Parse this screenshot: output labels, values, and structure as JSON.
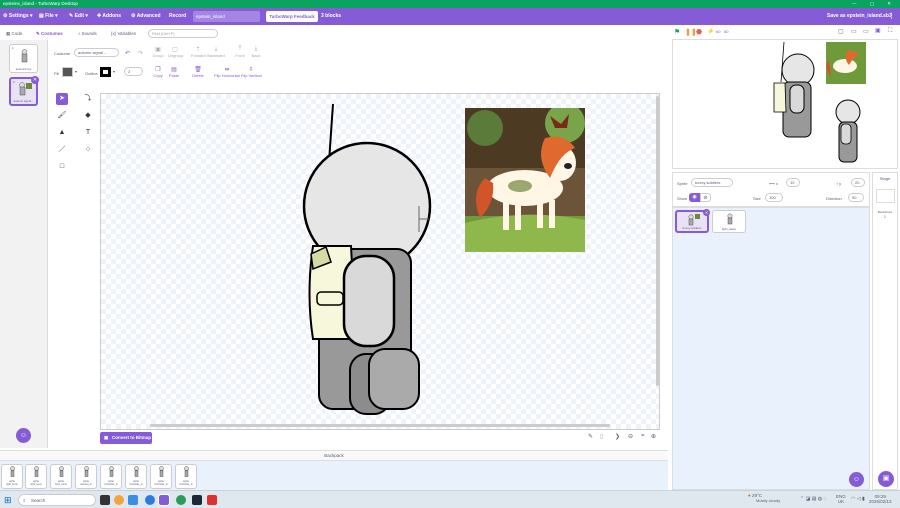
{
  "window": {
    "title": "epsteins_island - TurboWarp Desktop",
    "controls": "— ▢ ✕"
  },
  "menu": {
    "settings": "Settings",
    "file": "File",
    "edit": "Edit",
    "addons": "Addons",
    "advanced": "Advanced",
    "record": "Record",
    "project_name": "epstein_island",
    "feedback": "TurboWarp Feedback",
    "blocks_count": "3 blocks",
    "save_as": "Save as epstein_island.sb3"
  },
  "tabs": {
    "code": "Code",
    "costumes": "Costumes",
    "sounds": "Sounds",
    "variables": "Variables"
  },
  "costumes": [
    {
      "number": "1",
      "name": "autumn2 fop",
      "size": "..."
    },
    {
      "number": "2",
      "name": "autumn signal...",
      "size": "..."
    }
  ],
  "paint": {
    "find_placeholder": "Find (Ctrl+F)",
    "costume_label": "Costume",
    "costume_name": "autumn signal ...",
    "group": "Group",
    "ungroup": "Ungroup",
    "forward": "Forward",
    "backward": "Backward",
    "front": "Front",
    "back": "Back",
    "copy": "Copy",
    "paste": "Paste",
    "delete": "Delete",
    "flip_h": "Flip Horizontal",
    "flip_v": "Flip Vertical",
    "fill_label": "Fill",
    "outline_label": "Outline",
    "outline_size": "2",
    "convert_button": "Convert to Bitmap",
    "zoom_minus": "⊖",
    "zoom_reset": "=",
    "zoom_plus": "⊕",
    "fill_color": "#555555",
    "outline_color": "#000000"
  },
  "sprite_info": {
    "sprite_label": "Sprite",
    "sprite_name": "boxxy soldiers",
    "x_label": "x",
    "x_value": "10",
    "y_label": "y",
    "y_value": "20",
    "show_label": "Show",
    "size_label": "Size",
    "size_value": "100",
    "direction_label": "Direction",
    "direction_value": "90"
  },
  "sprites": [
    {
      "name": "boxxy soldiers",
      "selected": true
    },
    {
      "name": "light_slave",
      "selected": false
    }
  ],
  "stage_panel": {
    "title": "Stage",
    "backdrops_label": "Backdrops",
    "backdrops_count": "1"
  },
  "backpack": {
    "title": "Backpack",
    "items": [
      {
        "type": "sprite",
        "name": "light_bone"
      },
      {
        "type": "sprite",
        "name": "light_level"
      },
      {
        "type": "sprite",
        "name": "front_bone"
      },
      {
        "type": "sprite",
        "name": "camera_in"
      },
      {
        "type": "sprite",
        "name": "controller_in"
      },
      {
        "type": "sprite",
        "name": "controller_in"
      },
      {
        "type": "sprite",
        "name": "controller_in"
      },
      {
        "type": "sprite",
        "name": "controller_in"
      }
    ]
  },
  "taskbar": {
    "search": "Search",
    "weather_temp": "29°C",
    "weather_desc": "Mostly cloudy",
    "lang": "ENG",
    "region": "UK",
    "time": "09:29",
    "date": "2026/02/13"
  },
  "colors": {
    "accent": "#855cd6",
    "titlebar": "#0aa360"
  }
}
